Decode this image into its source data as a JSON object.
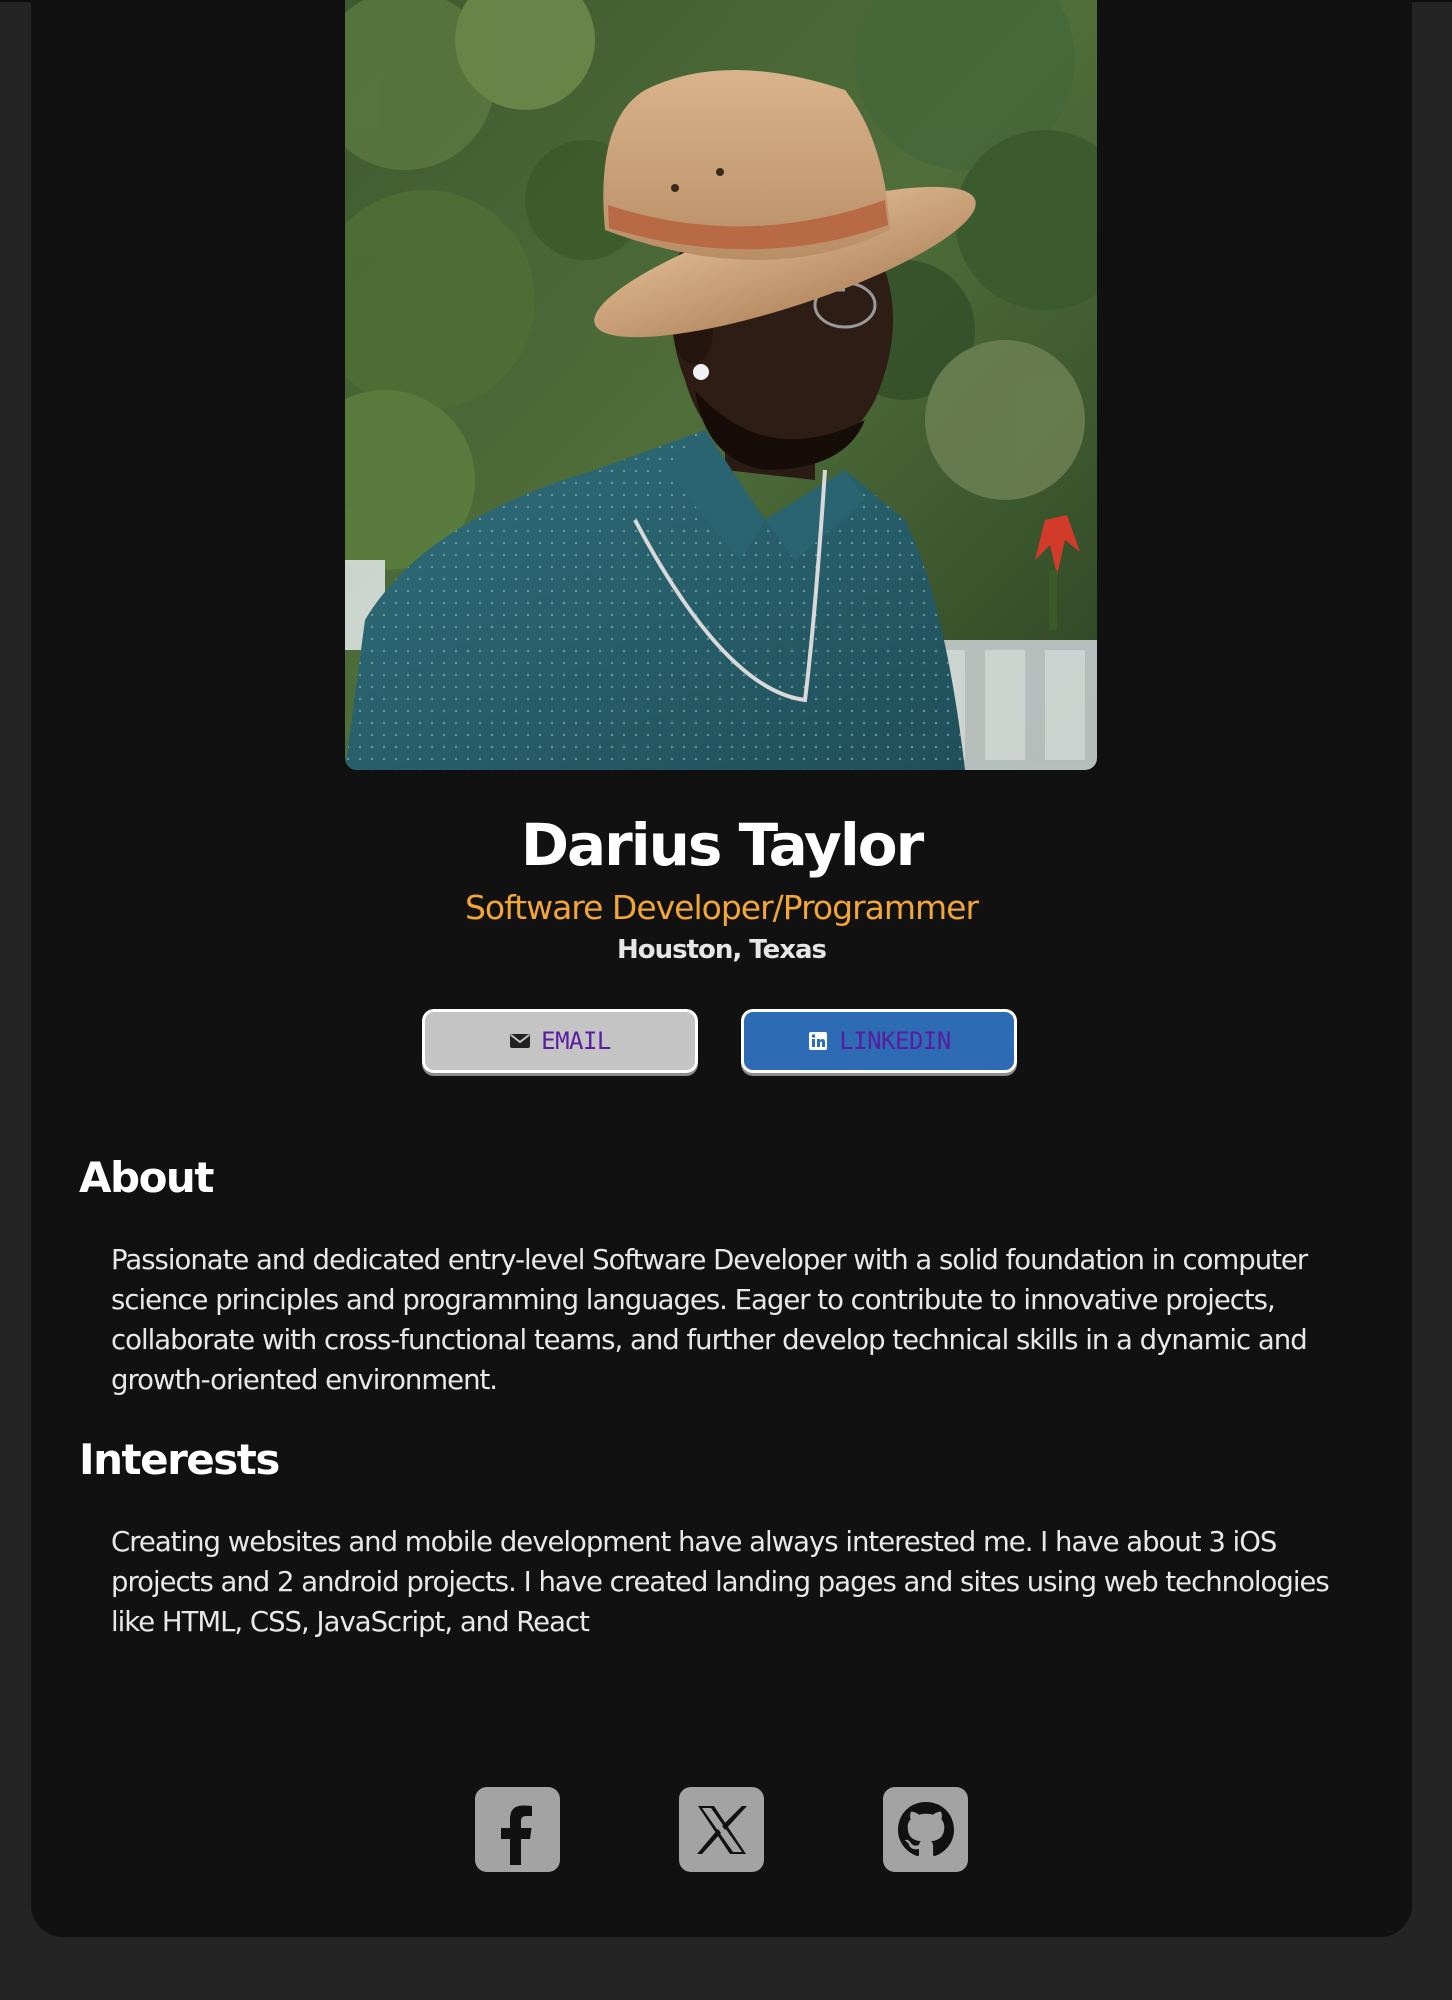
{
  "profile": {
    "photo_alt": "Darius Taylor",
    "name": "Darius Taylor",
    "role": "Software Developer/Programmer",
    "location": "Houston, Texas"
  },
  "buttons": {
    "email": {
      "label": "EMAIL",
      "icon": "envelope-icon"
    },
    "linkedin": {
      "label": "LINKEDIN",
      "icon": "linkedin-icon"
    }
  },
  "about": {
    "title": "About",
    "text": "Passionate and dedicated entry-level Software Developer with a solid foundation in computer science principles and programming languages. Eager to contribute to innovative projects, collaborate with cross-functional teams, and further develop technical skills in a dynamic and growth-oriented environment."
  },
  "interests": {
    "title": "Interests",
    "text": "Creating websites and mobile development have always interested me. I have about 3 iOS projects and 2 android projects. I have created landing pages and sites using web technologies like HTML, CSS, JavaScript, and React"
  },
  "footer": {
    "social": [
      {
        "icon": "facebook-icon"
      },
      {
        "icon": "x-twitter-icon"
      },
      {
        "icon": "github-icon"
      }
    ]
  },
  "colors": {
    "page_bg": "#242424",
    "card_bg": "#111111",
    "role_accent": "#f3a535",
    "email_button_bg": "#c4c4c4",
    "linkedin_button_bg": "#2d6bb4",
    "button_label": "#5a1ca0",
    "social_icon_bg": "#a3a3a3"
  }
}
